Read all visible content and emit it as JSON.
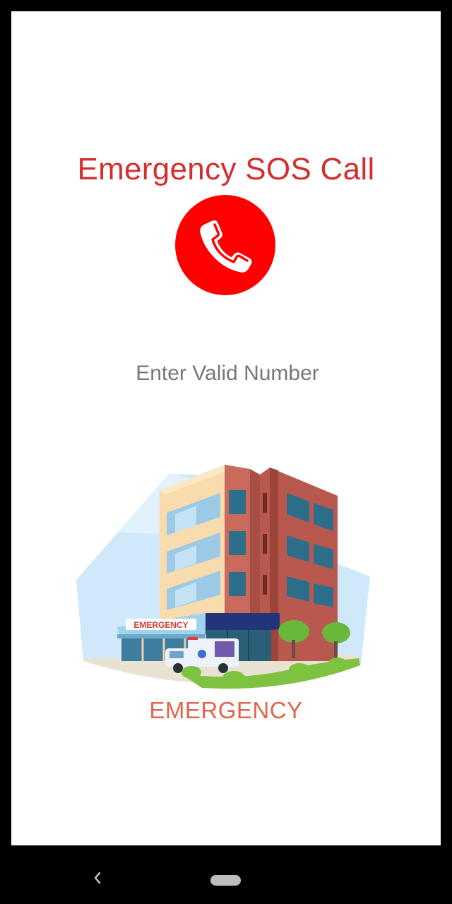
{
  "app": {
    "title": "Emergency SOS Call"
  },
  "call_button": {
    "icon": "phone-icon",
    "color": "#ff0000"
  },
  "number_input": {
    "placeholder": "Enter Valid Number",
    "value": ""
  },
  "illustration": {
    "sign_text": "EMERGENCY"
  },
  "footer": {
    "label": "EMERGENCY",
    "color": "#e4644f"
  },
  "colors": {
    "title": "#d32f2f",
    "background": "#ffffff"
  },
  "navbar": {
    "back_icon": "back-chevron-icon",
    "home_icon": "home-pill-icon"
  }
}
